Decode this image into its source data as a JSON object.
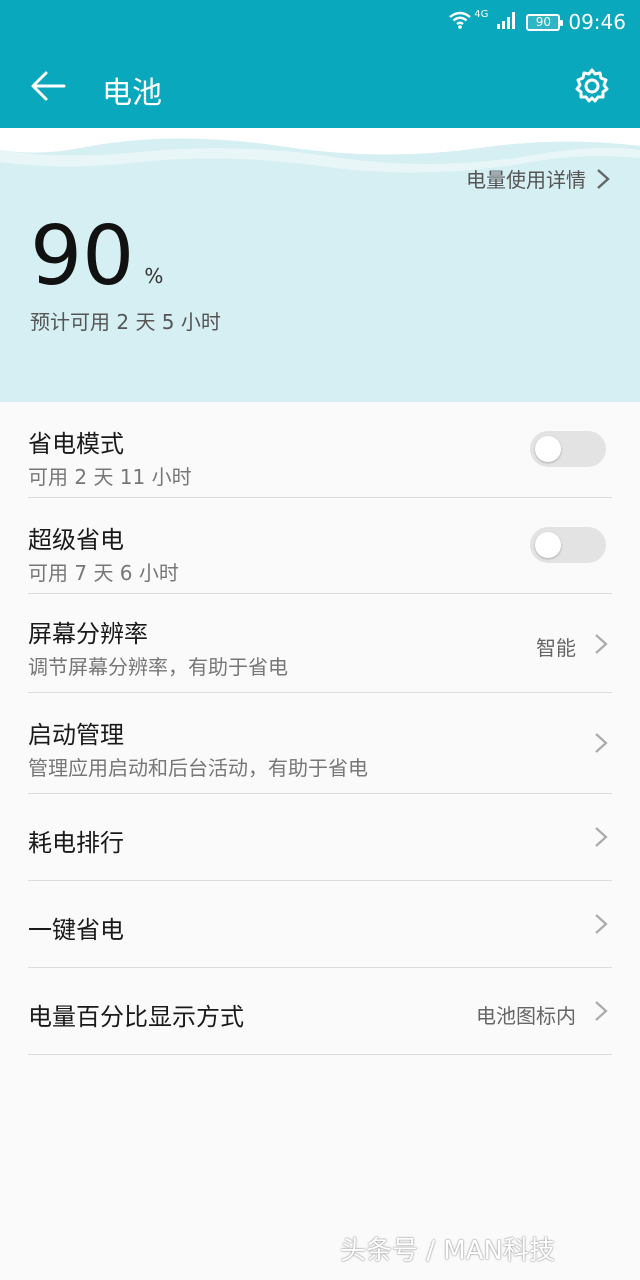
{
  "status_bar": {
    "network": "4G",
    "battery_level": "90",
    "time": "09:46"
  },
  "app_bar": {
    "title": "电池"
  },
  "hero": {
    "usage_details_link": "电量使用详情",
    "percent": "90",
    "percent_unit": "%",
    "estimate": "预计可用 2 天 5 小时"
  },
  "settings": [
    {
      "title": "省电模式",
      "subtitle": "可用 2 天 11 小时",
      "control": "toggle",
      "enabled": false
    },
    {
      "title": "超级省电",
      "subtitle": "可用 7 天 6 小时",
      "control": "toggle",
      "enabled": false
    },
    {
      "title": "屏幕分辨率",
      "subtitle": "调节屏幕分辨率，有助于省电",
      "value": "智能",
      "control": "chevron"
    },
    {
      "title": "启动管理",
      "subtitle": "管理应用启动和后台活动，有助于省电",
      "control": "chevron"
    },
    {
      "title": "耗电排行",
      "control": "chevron"
    },
    {
      "title": "一键省电",
      "control": "chevron"
    },
    {
      "title": "电量百分比显示方式",
      "value": "电池图标内",
      "control": "chevron"
    }
  ],
  "watermark": "头条号 / MAN科技",
  "colors": {
    "accent": "#0aa8bd",
    "hero_bg": "#d6eff2",
    "page_bg": "#fafafa"
  }
}
